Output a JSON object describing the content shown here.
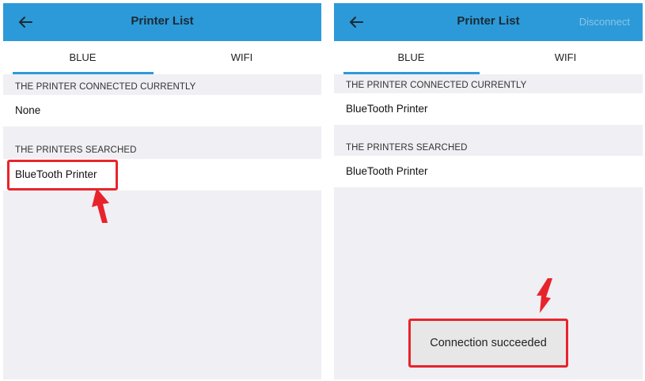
{
  "left_screen": {
    "header": {
      "title": "Printer List"
    },
    "tabs": [
      {
        "label": "BLUE"
      },
      {
        "label": "WIFI"
      }
    ],
    "connected_section": {
      "heading": "THE PRINTER CONNECTED CURRENTLY",
      "value": "None"
    },
    "searched_section": {
      "heading": "THE PRINTERS SEARCHED",
      "items": [
        "BlueTooth Printer"
      ]
    }
  },
  "right_screen": {
    "header": {
      "title": "Printer List",
      "action_label": "Disconnect"
    },
    "tabs": [
      {
        "label": "BLUE"
      },
      {
        "label": "WIFI"
      }
    ],
    "connected_section": {
      "heading": "THE PRINTER CONNECTED CURRENTLY",
      "value": "BlueTooth Printer"
    },
    "searched_section": {
      "heading": "THE PRINTERS SEARCHED",
      "items": [
        "BlueTooth Printer"
      ]
    },
    "toast": {
      "message": "Connection succeeded"
    }
  },
  "icons": {
    "back": "arrow-left-icon",
    "annotation": "red-arrow-icon"
  },
  "colors": {
    "header_bg": "#2c9ad8",
    "tab_underline": "#2c9ad8",
    "annotation_red": "#e8242b",
    "disconnect_text": "#8cc4e6",
    "page_bg": "#efeff4"
  }
}
